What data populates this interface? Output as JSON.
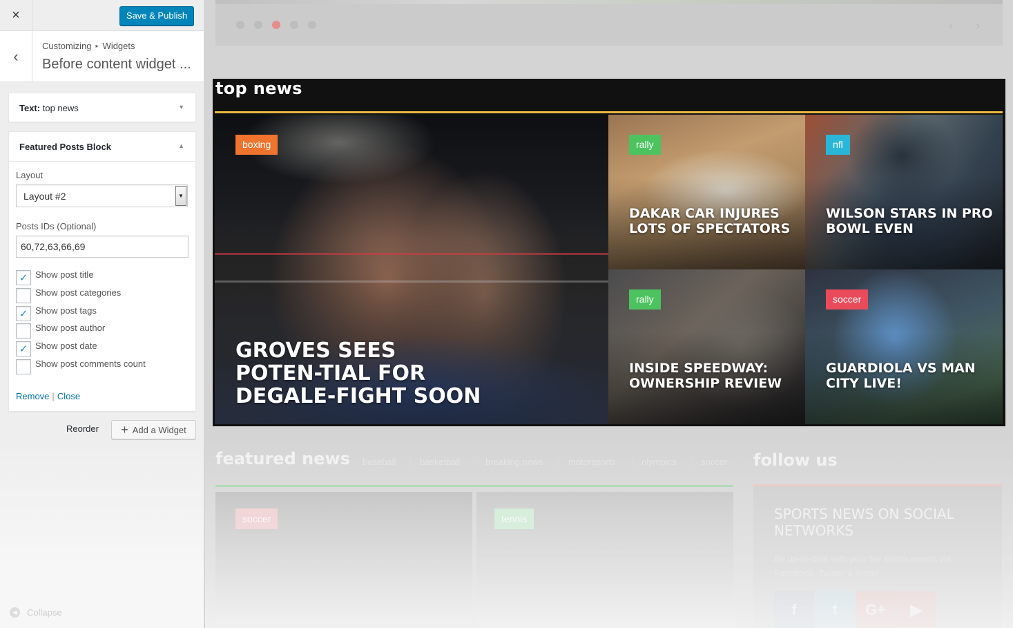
{
  "topbar": {
    "close_icon": "×",
    "publish_label": "Save & Publish"
  },
  "section": {
    "back_icon": "‹",
    "crumb_root": "Customizing",
    "crumb_sep": "▸",
    "crumb_leaf": "Widgets",
    "title": "Before content widget ..."
  },
  "widget_text": {
    "prefix": "Text:",
    "name": " top news",
    "arrow": "▼"
  },
  "widget_featured": {
    "title": "Featured Posts Block",
    "arrow": "▲",
    "layout_label": "Layout",
    "layout_value": "Layout #2",
    "ids_label": "Posts IDs (Optional)",
    "ids_value": "60,72,63,66,69",
    "options": [
      {
        "label": "Show post title",
        "checked": true
      },
      {
        "label": "Show post categories",
        "checked": false
      },
      {
        "label": "Show post tags",
        "checked": true
      },
      {
        "label": "Show post author",
        "checked": false
      },
      {
        "label": "Show post date",
        "checked": true
      },
      {
        "label": "Show post comments count",
        "checked": false
      }
    ],
    "remove": "Remove",
    "close": "Close"
  },
  "actions": {
    "reorder": "Reorder",
    "add_widget": "Add a Widget",
    "add_icon": "+"
  },
  "collapse": {
    "label": "Collapse",
    "icon": "◀"
  },
  "slider": {
    "dots": 5,
    "active_dot": 3,
    "prev": "‹",
    "next": "›"
  },
  "top_news": {
    "title": "top news",
    "accent": "#e8b83f",
    "tiles": [
      {
        "category": "boxing",
        "color": "#f0732e",
        "title": "Groves sees poten-tial for DeGale-fight soon"
      },
      {
        "category": "rally",
        "color": "#4cc35f",
        "title": "Dakar car injures lots of spectators"
      },
      {
        "category": "nfl",
        "color": "#29b6d8",
        "title": "Wilson stars in Pro Bowl even"
      },
      {
        "category": "rally",
        "color": "#4cc35f",
        "title": "Inside Speedway: Ownership Review"
      },
      {
        "category": "soccer",
        "color": "#e94b5b",
        "title": "Guardiola vs Man City live!"
      }
    ]
  },
  "featured_news": {
    "title": "featured news",
    "tabs": [
      "baseball",
      "basketball",
      "breaking news",
      "motorsports",
      "olympics",
      "soccer"
    ],
    "badges": [
      {
        "label": "soccer",
        "color": "#f2c8cc"
      },
      {
        "label": "tennis",
        "color": "#c8eccf"
      }
    ]
  },
  "follow_us": {
    "title": "follow us",
    "heading": "Sports news on social networks",
    "text": "Be up-to-date with your fav sports events via Facebook, Twitter & more!",
    "icons": [
      {
        "name": "facebook-icon",
        "glyph": "f",
        "color": "#b9c0cf"
      },
      {
        "name": "twitter-icon",
        "glyph": "t",
        "color": "#b8d3e2"
      },
      {
        "name": "google-plus-icon",
        "glyph": "G+",
        "color": "#e0b7b2"
      },
      {
        "name": "youtube-icon",
        "glyph": "▶",
        "color": "#e2b6b6"
      }
    ]
  }
}
